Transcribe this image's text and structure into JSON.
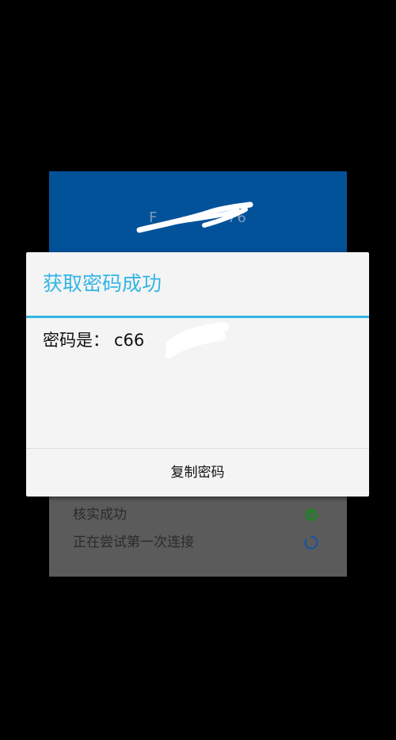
{
  "background_card": {
    "ssid_partial": "F             76",
    "status_items": [
      {
        "label": "核实成功",
        "state": "success",
        "icon": "check-circle-icon"
      },
      {
        "label": "正在尝试第一次连接",
        "state": "loading",
        "icon": "spinner-icon"
      }
    ]
  },
  "dialog": {
    "title": "获取密码成功",
    "message_prefix": "密码是：",
    "password_visible": "c66      8",
    "button_label": "复制密码"
  },
  "colors": {
    "header_blue": "#02529a",
    "accent": "#33b5e5",
    "success_green": "#2e9a36",
    "spinner_blue": "#1a6fd6"
  }
}
